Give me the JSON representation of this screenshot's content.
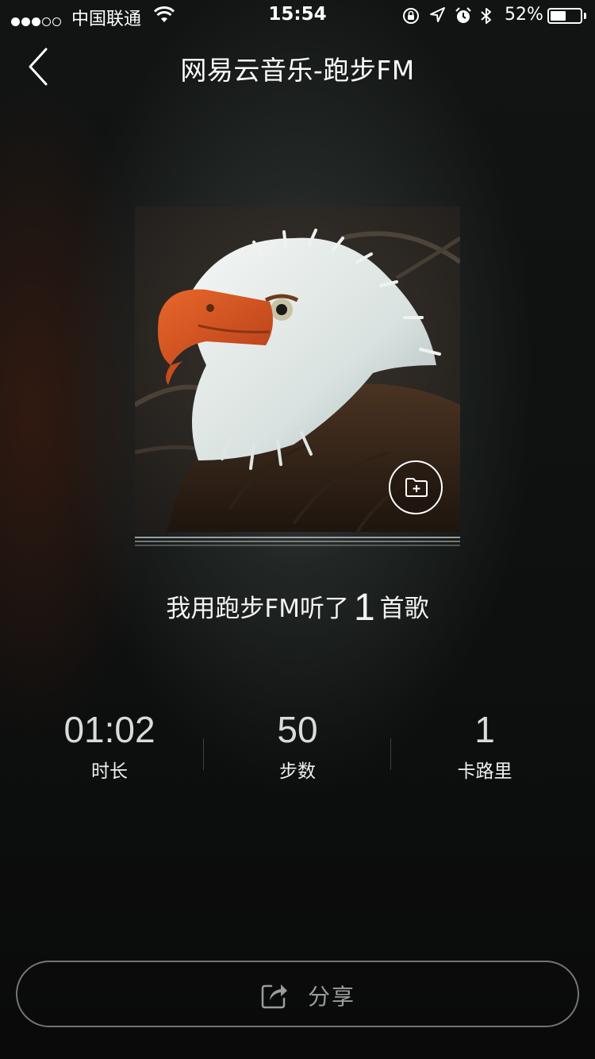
{
  "status_bar": {
    "carrier": "中国联通",
    "time": "15:54",
    "battery_percent": "52%",
    "battery_level": 0.52,
    "signal_bars_filled": 3,
    "signal_bars_total": 5,
    "icons": [
      "wifi-icon",
      "rotation-lock-icon",
      "location-icon",
      "alarm-icon",
      "bluetooth-icon",
      "battery-icon"
    ]
  },
  "nav": {
    "back_icon": "chevron-left-icon",
    "title": "网易云音乐-跑步FM"
  },
  "album": {
    "cover": "bald-eagle-album-art",
    "add_icon": "folder-plus-icon"
  },
  "summary": {
    "prefix": "我用跑步FM听了",
    "count": "1",
    "suffix": "首歌"
  },
  "stats": [
    {
      "value": "01:02",
      "label": "时长"
    },
    {
      "value": "50",
      "label": "步数"
    },
    {
      "value": "1",
      "label": "卡路里"
    }
  ],
  "share": {
    "label": "分享",
    "icon": "share-icon"
  },
  "colors": {
    "background": "#0b0b0b",
    "text_primary": "#ffffff",
    "stat_value": "#d8dcda",
    "share_text": "#9a9d9c"
  }
}
